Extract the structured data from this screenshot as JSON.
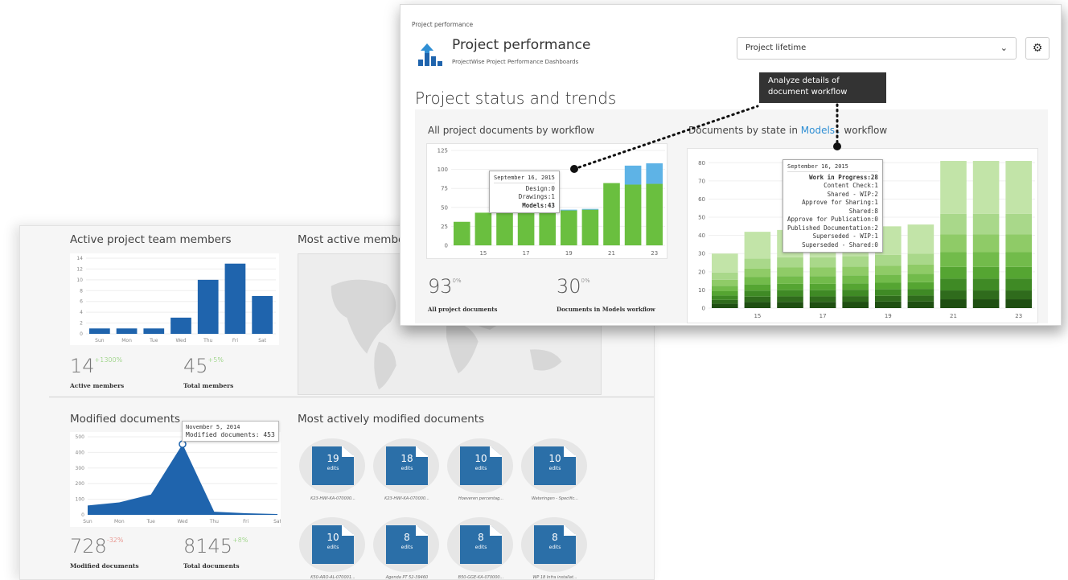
{
  "back": {
    "team": {
      "title": "Active project team members",
      "days": [
        "Sun",
        "Mon",
        "Tue",
        "Wed",
        "Thu",
        "Fri",
        "Sat"
      ],
      "yticks": [
        "14",
        "12",
        "10",
        "8",
        "6",
        "4",
        "2",
        "0"
      ],
      "stat1_value": "14",
      "stat1_delta": "+1300%",
      "stat1_label": "Active members",
      "stat2_value": "45",
      "stat2_delta": "+5%",
      "stat2_label": "Total members"
    },
    "map": {
      "title": "Most active members"
    },
    "modified": {
      "title": "Modified documents",
      "days": [
        "Sun",
        "Mon",
        "Tue",
        "Wed",
        "Thu",
        "Fri",
        "Sat"
      ],
      "yticks": [
        "500",
        "400",
        "300",
        "200",
        "100",
        "0"
      ],
      "tooltip_date": "November 5, 2014",
      "tooltip_value": "Modified documents: 453",
      "stat1_value": "728",
      "stat1_delta": "-32%",
      "stat1_label": "Modified documents",
      "stat2_value": "8145",
      "stat2_delta": "+8%",
      "stat2_label": "Total documents"
    },
    "most_modified": {
      "title": "Most actively modified documents",
      "docs": [
        {
          "count": "19",
          "unit": "edits",
          "name": "K23-HWI-KA-070000..."
        },
        {
          "count": "18",
          "unit": "edits",
          "name": "K23-HWI-KA-070000..."
        },
        {
          "count": "10",
          "unit": "edits",
          "name": "Hoeveren percentag..."
        },
        {
          "count": "10",
          "unit": "edits",
          "name": "Wateringen - Specific..."
        },
        {
          "count": "10",
          "unit": "edits",
          "name": "K50-ARO-AL-070001..."
        },
        {
          "count": "8",
          "unit": "edits",
          "name": "Agenda PT 52-39460"
        },
        {
          "count": "8",
          "unit": "edits",
          "name": "B50-GGE-KA-070000..."
        },
        {
          "count": "8",
          "unit": "edits",
          "name": "WP 18 Infra installat..."
        }
      ]
    }
  },
  "front": {
    "breadcrumb": "Project performance",
    "app_title": "Project performance",
    "app_subtitle": "ProjectWise Project Performance Dashboards",
    "select_value": "Project lifetime",
    "section_title": "Project status and trends",
    "callout": [
      "Analyze details of",
      "document workflow"
    ],
    "left_panel": {
      "title": "All project documents by workflow",
      "tooltip": {
        "date": "September 16, 2015",
        "lines": [
          "Design:0",
          "Drawings:1"
        ],
        "bold": "Models:43"
      },
      "stat1_value": "93",
      "stat1_sup": "0%",
      "stat1_label": "All project documents",
      "stat2_value": "30",
      "stat2_sup": "0%",
      "stat2_label": "Documents in Models workflow"
    },
    "right_panel": {
      "title_pre": "Documents by state in",
      "title_link": "Models",
      "title_post": "workflow",
      "tooltip": {
        "date": "September 16, 2015",
        "bold": "Work in Progress:28",
        "lines": [
          "Content Check:1",
          "Shared - WIP:2",
          "Approve for Sharing:1",
          "Shared:8",
          "Approve for Publication:0",
          "Published Documentation:2",
          "Superseded - WIP:1",
          "Superseded - Shared:0"
        ]
      }
    }
  },
  "colors": {
    "blue_dark": "#1f64ad",
    "green": "#6abf3f",
    "light_blue": "#5eb3e6",
    "callout_bg": "#333333"
  },
  "chart_data": [
    {
      "type": "bar",
      "title": "Active project team members",
      "categories": [
        "Sun",
        "Mon",
        "Tue",
        "Wed",
        "Thu",
        "Fri",
        "Sat"
      ],
      "values": [
        1,
        1,
        1,
        3,
        10,
        13,
        7
      ],
      "ylim": [
        0,
        14
      ]
    },
    {
      "type": "area",
      "title": "Modified documents",
      "categories": [
        "Sun",
        "Mon",
        "Tue",
        "Wed",
        "Thu",
        "Fri",
        "Sat"
      ],
      "values": [
        60,
        80,
        130,
        453,
        20,
        10,
        5
      ],
      "ylim": [
        0,
        500
      ]
    },
    {
      "type": "bar",
      "title": "All project documents by workflow",
      "x": [
        14,
        15,
        16,
        17,
        18,
        19,
        20,
        21,
        22,
        23
      ],
      "xticks": [
        "15",
        "17",
        "19",
        "21",
        "23"
      ],
      "yticks": [
        "125",
        "100",
        "75",
        "50",
        "25",
        "0"
      ],
      "ylim": [
        0,
        125
      ],
      "series": [
        {
          "values": [
            31,
            43,
            44,
            45,
            46,
            46,
            47,
            82,
            80,
            81
          ]
        },
        {
          "values": [
            0,
            0,
            0,
            0,
            0,
            1,
            1,
            0,
            25,
            27
          ]
        }
      ]
    },
    {
      "type": "bar",
      "title": "Documents by state in Models workflow",
      "x": [
        14,
        15,
        16,
        17,
        18,
        19,
        20,
        21,
        22,
        23
      ],
      "xticks": [
        "15",
        "17",
        "19",
        "21",
        "23"
      ],
      "yticks": [
        "80",
        "70",
        "60",
        "50",
        "40",
        "30",
        "20",
        "10",
        "0"
      ],
      "ylim": [
        0,
        85
      ],
      "series": [
        {
          "values": [
            30,
            42,
            43,
            43,
            44,
            45,
            46,
            81,
            81,
            81
          ]
        }
      ]
    }
  ]
}
